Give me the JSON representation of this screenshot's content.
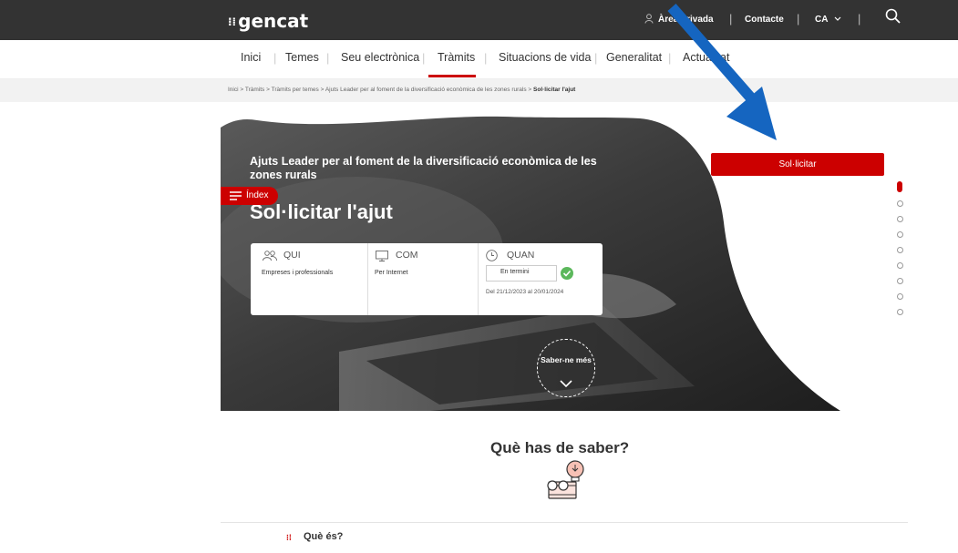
{
  "header": {
    "logo_text": "gencat",
    "logo_mark": "⁝⁞",
    "user_icon": "user-icon",
    "area_privada": "Àrea privada",
    "contacte": "Contacte",
    "language": "CA",
    "search_icon": "search-icon"
  },
  "menu": {
    "items": [
      "Inici",
      "Temes",
      "Seu electrònica",
      "Tràmits",
      "Situacions de vida",
      "Generalitat",
      "Actualitat"
    ],
    "active": "Tràmits"
  },
  "breadcrumb": {
    "items": [
      "Inici",
      "Tràmits",
      "Tràmits per temes",
      "Ajuts Leader per al foment de la diversificació econòmica de les zones rurals"
    ],
    "current": "Sol·licitar l'ajut",
    "separator": ">"
  },
  "hero": {
    "subtitle": "Ajuts Leader per al foment de la diversificació econòmica de les zones rurals",
    "title": "Sol·licitar l'ajut",
    "index_label": "Índex",
    "saber_mes": "Saber-ne més"
  },
  "info_card": {
    "qui_label": "QUI",
    "qui_value": "Empreses i professionals",
    "com_label": "COM",
    "com_value": "Per Internet",
    "quan_label": "QUAN",
    "status": "En termini",
    "dates": "Del 21/12/2023 al 20/01/2024"
  },
  "actions": {
    "sollicitar_label": "Sol·licitar"
  },
  "section": {
    "heading": "Què has de saber?",
    "first_item": "Què és?"
  },
  "colors": {
    "brand_red": "#cc0000",
    "topbar": "#333333",
    "arrow": "#1565c0"
  }
}
